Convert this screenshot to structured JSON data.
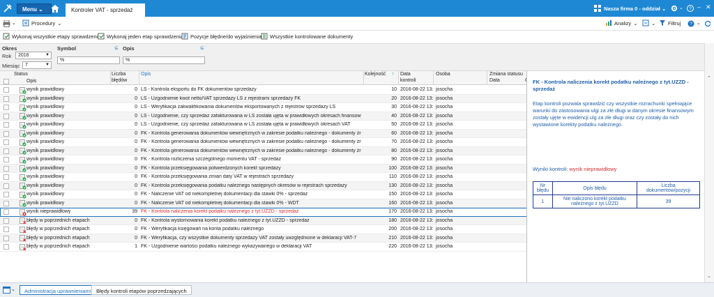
{
  "topbar": {
    "menu_label": "Menu",
    "active_tab": "Kontroler VAT - sprzedaż",
    "company": "Nasza firma 0 - oddział"
  },
  "toolbar": {
    "procedures_label": "Procedury",
    "analyses_label": "Analizy",
    "filter_label": "Filtruj"
  },
  "actions": [
    "Wykonaj wszystkie etapy sprawdzenia",
    "Wykonaj jeden etap sprawdzenia",
    "Pozycje błędne/do wyjaśnienia",
    "Wszystkie kontrolowane dokumenty"
  ],
  "filters": {
    "okres_label": "Okres",
    "rok_label": "Rok",
    "rok_value": "2016",
    "miesiac_label": "Miesiąc",
    "miesiac_value": "7",
    "symbol_label": "Symbol",
    "symbol_value": "%",
    "opis_label": "Opis",
    "opis_value": "%"
  },
  "grid": {
    "headers": {
      "status": "Status",
      "opis_small": "Opis",
      "liczba1": "Liczba",
      "liczba2": "błędów",
      "opis": "Opis",
      "kolejnosc": "Kolejność",
      "data1": "Data",
      "data2": "kontroli",
      "osoba": "Osoba",
      "zmiana": "Zmiana statusu",
      "zm_data": "Data",
      "zm_o": "O"
    },
    "rows": [
      {
        "status_icon": "ok",
        "status": "wynik prawidłowy",
        "count": "0",
        "desc": "LS - Kontrola eksportu do FK dokumentów sprzedaży",
        "order": "10",
        "date": "2016-08-22 13:",
        "person": "josocha"
      },
      {
        "status_icon": "ok",
        "status": "wynik prawidłowy",
        "count": "0",
        "desc": "LS - Uzgodnienie kwot netto/VAT sprzedaży LS  z rejestrami sprzedaży FK",
        "order": "20",
        "date": "2016-08-22 13:",
        "person": "josocha"
      },
      {
        "status_icon": "ok",
        "status": "wynik prawidłowy",
        "count": "0",
        "desc": "LS - Weryfikacja zakwalifikowania dokumentów eksportowanych z rejestrów sprzedaży LS",
        "order": "30",
        "date": "2016-08-22 13:",
        "person": "josocha"
      },
      {
        "status_icon": "ok",
        "status": "wynik prawidłowy",
        "count": "0",
        "desc": "LS - Uzgodnienie, czy sprzedaż zafakturowana w LS została ujęta w prawidłowych okresach finansowy",
        "order": "40",
        "date": "2016-08-22 13:",
        "person": "josocha"
      },
      {
        "status_icon": "ok",
        "status": "wynik prawidłowy",
        "count": "0",
        "desc": "LS - Uzgodnienie, czy sprzedaż zafakturowana w LS została ujęta w prawidłowych okresach VAT",
        "order": "50",
        "date": "2016-08-22 13:",
        "person": "josocha"
      },
      {
        "status_icon": "ok",
        "status": "wynik prawidłowy",
        "count": "0",
        "desc": "FK - Kontrola generowania dokumentów wewnętrznych w zakresie podatku należnego - dokumenty źró",
        "order": "60",
        "date": "2016-08-22 13:",
        "person": "josocha"
      },
      {
        "status_icon": "ok",
        "status": "wynik prawidłowy",
        "count": "0",
        "desc": "FK - Kontrola generowania dokumentów wewnętrznych w zakresie podatku należnego - dokumenty źró",
        "order": "70",
        "date": "2016-08-22 13:",
        "person": "josocha"
      },
      {
        "status_icon": "ok",
        "status": "wynik prawidłowy",
        "count": "0",
        "desc": "FK - Kontrola generowania dokumentów wewnętrznych w zakresie podatku należnego - dokumenty źró",
        "order": "80",
        "date": "2016-08-22 13:",
        "person": "josocha"
      },
      {
        "status_icon": "ok",
        "status": "wynik prawidłowy",
        "count": "0",
        "desc": "FK - Kontrola rozliczenia szczególnego momentu VAT - sprzedaż",
        "order": "90",
        "date": "2016-08-22 13:",
        "person": "josocha"
      },
      {
        "status_icon": "ok",
        "status": "wynik prawidłowy",
        "count": "0",
        "desc": "FK - Kontrola przeksięgowania potwierdzonych korekt sprzedaży",
        "order": "100",
        "date": "2016-08-22 13:",
        "person": "josocha"
      },
      {
        "status_icon": "ok",
        "status": "wynik prawidłowy",
        "count": "0",
        "desc": "FK - Kontrola przeksięgowania zmian daty VAT w rejestrach sprzedaży",
        "order": "110",
        "date": "2016-08-22 13:",
        "person": "josocha"
      },
      {
        "status_icon": "ok",
        "status": "wynik prawidłowy",
        "count": "0",
        "desc": "FK - Kontrola przeksięgowania podatku należnego następnych okresów  w rejestrach sprzedaży",
        "order": "130",
        "date": "2016-08-22 13:",
        "person": "josocha"
      },
      {
        "status_icon": "ok",
        "status": "wynik prawidłowy",
        "count": "0",
        "desc": "FK - Naliczenie VAT od niekompletnej dokumentacji dla stawki 0% - sprzedaż",
        "order": "150",
        "date": "2016-08-22 13:",
        "person": "josocha"
      },
      {
        "status_icon": "ok",
        "status": "wynik prawidłowy",
        "count": "0",
        "desc": "FK - Naliczenie VAT od niekompletnej dokumentacji dla stawki 0% -   WDT",
        "order": "160",
        "date": "2016-08-22 13:",
        "person": "josocha"
      },
      {
        "status_icon": "bad",
        "status": "wynik nieprawidłowy",
        "count": "39",
        "desc": "FK - Kontrola naliczenia korekt podatku należnego z tyt.UZZD - sprzedaż",
        "order": "170",
        "date": "2016-08-22 13:",
        "person": "josocha"
      },
      {
        "status_icon": "prev",
        "status": "błędy w poprzednich etapach",
        "count": "0",
        "desc": "FK - Kontrola wystornowania korekt podatku należnego z tyt.UZZD - sprzedaż",
        "order": "180",
        "date": "2016-08-22 13:",
        "person": "josocha"
      },
      {
        "status_icon": "prev",
        "status": "błędy w poprzednich etapach",
        "count": "0",
        "desc": "FK - Weryfikacja księgowań na konta podatku należnego",
        "order": "200",
        "date": "2016-08-22 13:",
        "person": "josocha"
      },
      {
        "status_icon": "prev",
        "status": "błędy w poprzednich etapach",
        "count": "0",
        "desc": "FK - Weryfikacja, czy wszystkie dokumenty sprzedaży VAT zostały uwzględnione w deklaracji VAT-7",
        "order": "210",
        "date": "2016-08-22 13:",
        "person": "josocha"
      },
      {
        "status_icon": "prev",
        "status": "błędy w poprzednich etapach",
        "count": "1",
        "desc": "FK - Uzgodnienie wartości podatku należnego wykazywanego w deklaracji VAT",
        "order": "220",
        "date": "2016-08-22 13:",
        "person": "josocha"
      }
    ]
  },
  "detail": {
    "title": "FK - Kontrola naliczenia korekt podatku należnego z tyt.UZZD - sprzedaż",
    "description": "Etap kontroli pozwala sprawdzić czy wszystkie rozrachunki spełniające warunki do zastosowania ulgi za złe długi w danym okresie finansowym zostały ujęte w ewidencji ulg za złe długi oraz czy zostały do nich wystawione korekty podatku należnego.",
    "result_label": "Wyniki kontroli:",
    "result_value": "wynik nieprawidłowy",
    "table": {
      "h1": "Nr błędu",
      "h2": "Opis błędu",
      "h3": "Liczba dokumentów/pozycji",
      "r_nr": "1",
      "r_desc": "Nie naliczono korekt podatku należnego z tyt.UZZD",
      "r_count": "39"
    }
  },
  "bottom": {
    "tab1": "Administracja uprawnieniami",
    "tab2": "Błędy kontroli etapów poprzedzających"
  },
  "colors": {
    "topbar": "#1e88d4",
    "accent": "#1e73be",
    "error": "#d32f2f",
    "ok": "#2e9e4f"
  }
}
